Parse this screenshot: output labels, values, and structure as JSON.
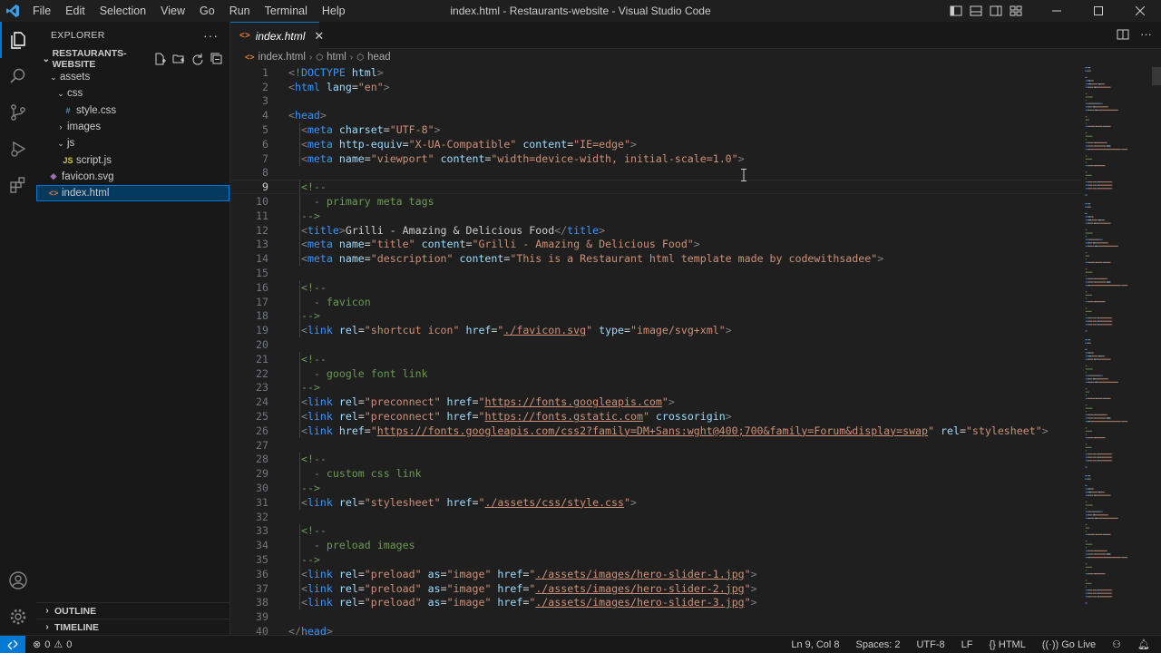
{
  "app": {
    "window_title": "index.html - Restaurants-website - Visual Studio Code",
    "menu": [
      "File",
      "Edit",
      "Selection",
      "View",
      "Go",
      "Run",
      "Terminal",
      "Help"
    ]
  },
  "sidebar": {
    "header": "EXPLORER",
    "section": "RESTAURANTS-WEBSITE",
    "tree": [
      {
        "label": "assets",
        "type": "folder",
        "open": true,
        "depth": 1
      },
      {
        "label": "css",
        "type": "folder",
        "open": true,
        "depth": 2
      },
      {
        "label": "style.css",
        "type": "css",
        "depth": 3
      },
      {
        "label": "images",
        "type": "folder",
        "open": false,
        "depth": 2
      },
      {
        "label": "js",
        "type": "folder",
        "open": true,
        "depth": 2
      },
      {
        "label": "script.js",
        "type": "js",
        "depth": 3
      },
      {
        "label": "favicon.svg",
        "type": "svg",
        "depth": 1
      },
      {
        "label": "index.html",
        "type": "html",
        "depth": 1,
        "selected": true
      }
    ],
    "outline": "OUTLINE",
    "timeline": "TIMELINE"
  },
  "editor": {
    "tab_label": "index.html",
    "breadcrumb": [
      "index.html",
      "html",
      "head"
    ],
    "current_line": 9,
    "lines": [
      [
        [
          "brk",
          "<!"
        ],
        [
          "tag",
          "DOCTYPE"
        ],
        [
          "txt",
          " "
        ],
        [
          "attr",
          "html"
        ],
        [
          "brk",
          ">"
        ]
      ],
      [
        [
          "brk",
          "<"
        ],
        [
          "tag",
          "html"
        ],
        [
          "txt",
          " "
        ],
        [
          "attr",
          "lang"
        ],
        [
          "txt",
          "="
        ],
        [
          "str",
          "\"en\""
        ],
        [
          "brk",
          ">"
        ]
      ],
      [],
      [
        [
          "brk",
          "<"
        ],
        [
          "tag",
          "head"
        ],
        [
          "brk",
          ">"
        ]
      ],
      [
        [
          "txt",
          "  "
        ],
        [
          "brk",
          "<"
        ],
        [
          "tag",
          "meta"
        ],
        [
          "txt",
          " "
        ],
        [
          "attr",
          "charset"
        ],
        [
          "txt",
          "="
        ],
        [
          "str",
          "\"UTF-8\""
        ],
        [
          "brk",
          ">"
        ]
      ],
      [
        [
          "txt",
          "  "
        ],
        [
          "brk",
          "<"
        ],
        [
          "tag",
          "meta"
        ],
        [
          "txt",
          " "
        ],
        [
          "attr",
          "http-equiv"
        ],
        [
          "txt",
          "="
        ],
        [
          "str",
          "\"X-UA-Compatible\""
        ],
        [
          "txt",
          " "
        ],
        [
          "attr",
          "content"
        ],
        [
          "txt",
          "="
        ],
        [
          "str",
          "\"IE=edge\""
        ],
        [
          "brk",
          ">"
        ]
      ],
      [
        [
          "txt",
          "  "
        ],
        [
          "brk",
          "<"
        ],
        [
          "tag",
          "meta"
        ],
        [
          "txt",
          " "
        ],
        [
          "attr",
          "name"
        ],
        [
          "txt",
          "="
        ],
        [
          "str",
          "\"viewport\""
        ],
        [
          "txt",
          " "
        ],
        [
          "attr",
          "content"
        ],
        [
          "txt",
          "="
        ],
        [
          "str",
          "\"width=device-width, initial-scale=1.0\""
        ],
        [
          "brk",
          ">"
        ]
      ],
      [],
      [
        [
          "txt",
          "  "
        ],
        [
          "cmt",
          "<!--"
        ]
      ],
      [
        [
          "txt",
          "  "
        ],
        [
          "cmt",
          "  - primary meta tags"
        ]
      ],
      [
        [
          "txt",
          "  "
        ],
        [
          "cmt",
          "-->"
        ]
      ],
      [
        [
          "txt",
          "  "
        ],
        [
          "brk",
          "<"
        ],
        [
          "tag",
          "title"
        ],
        [
          "brk",
          ">"
        ],
        [
          "txt",
          "Grilli - Amazing & Delicious Food"
        ],
        [
          "brk",
          "</"
        ],
        [
          "tag",
          "title"
        ],
        [
          "brk",
          ">"
        ]
      ],
      [
        [
          "txt",
          "  "
        ],
        [
          "brk",
          "<"
        ],
        [
          "tag",
          "meta"
        ],
        [
          "txt",
          " "
        ],
        [
          "attr",
          "name"
        ],
        [
          "txt",
          "="
        ],
        [
          "str",
          "\"title\""
        ],
        [
          "txt",
          " "
        ],
        [
          "attr",
          "content"
        ],
        [
          "txt",
          "="
        ],
        [
          "str",
          "\"Grilli - Amazing & Delicious Food\""
        ],
        [
          "brk",
          ">"
        ]
      ],
      [
        [
          "txt",
          "  "
        ],
        [
          "brk",
          "<"
        ],
        [
          "tag",
          "meta"
        ],
        [
          "txt",
          " "
        ],
        [
          "attr",
          "name"
        ],
        [
          "txt",
          "="
        ],
        [
          "str",
          "\"description\""
        ],
        [
          "txt",
          " "
        ],
        [
          "attr",
          "content"
        ],
        [
          "txt",
          "="
        ],
        [
          "str",
          "\"This is a Restaurant html template made by codewithsadee\""
        ],
        [
          "brk",
          ">"
        ]
      ],
      [],
      [
        [
          "txt",
          "  "
        ],
        [
          "cmt",
          "<!--"
        ]
      ],
      [
        [
          "txt",
          "  "
        ],
        [
          "cmt",
          "  - favicon"
        ]
      ],
      [
        [
          "txt",
          "  "
        ],
        [
          "cmt",
          "-->"
        ]
      ],
      [
        [
          "txt",
          "  "
        ],
        [
          "brk",
          "<"
        ],
        [
          "tag",
          "link"
        ],
        [
          "txt",
          " "
        ],
        [
          "attr",
          "rel"
        ],
        [
          "txt",
          "="
        ],
        [
          "str",
          "\"shortcut icon\""
        ],
        [
          "txt",
          " "
        ],
        [
          "attr",
          "href"
        ],
        [
          "txt",
          "="
        ],
        [
          "str",
          "\""
        ],
        [
          "url",
          "./favicon.svg"
        ],
        [
          "str",
          "\""
        ],
        [
          "txt",
          " "
        ],
        [
          "attr",
          "type"
        ],
        [
          "txt",
          "="
        ],
        [
          "str",
          "\"image/svg+xml\""
        ],
        [
          "brk",
          ">"
        ]
      ],
      [],
      [
        [
          "txt",
          "  "
        ],
        [
          "cmt",
          "<!--"
        ]
      ],
      [
        [
          "txt",
          "  "
        ],
        [
          "cmt",
          "  - google font link"
        ]
      ],
      [
        [
          "txt",
          "  "
        ],
        [
          "cmt",
          "-->"
        ]
      ],
      [
        [
          "txt",
          "  "
        ],
        [
          "brk",
          "<"
        ],
        [
          "tag",
          "link"
        ],
        [
          "txt",
          " "
        ],
        [
          "attr",
          "rel"
        ],
        [
          "txt",
          "="
        ],
        [
          "str",
          "\"preconnect\""
        ],
        [
          "txt",
          " "
        ],
        [
          "attr",
          "href"
        ],
        [
          "txt",
          "="
        ],
        [
          "str",
          "\""
        ],
        [
          "url",
          "https://fonts.googleapis.com"
        ],
        [
          "str",
          "\""
        ],
        [
          "brk",
          ">"
        ]
      ],
      [
        [
          "txt",
          "  "
        ],
        [
          "brk",
          "<"
        ],
        [
          "tag",
          "link"
        ],
        [
          "txt",
          " "
        ],
        [
          "attr",
          "rel"
        ],
        [
          "txt",
          "="
        ],
        [
          "str",
          "\"preconnect\""
        ],
        [
          "txt",
          " "
        ],
        [
          "attr",
          "href"
        ],
        [
          "txt",
          "="
        ],
        [
          "str",
          "\""
        ],
        [
          "url",
          "https://fonts.gstatic.com"
        ],
        [
          "str",
          "\""
        ],
        [
          "txt",
          " "
        ],
        [
          "attr",
          "crossorigin"
        ],
        [
          "brk",
          ">"
        ]
      ],
      [
        [
          "txt",
          "  "
        ],
        [
          "brk",
          "<"
        ],
        [
          "tag",
          "link"
        ],
        [
          "txt",
          " "
        ],
        [
          "attr",
          "href"
        ],
        [
          "txt",
          "="
        ],
        [
          "str",
          "\""
        ],
        [
          "url",
          "https://fonts.googleapis.com/css2?family=DM+Sans:wght@400;700&family=Forum&display=swap"
        ],
        [
          "str",
          "\""
        ],
        [
          "txt",
          " "
        ],
        [
          "attr",
          "rel"
        ],
        [
          "txt",
          "="
        ],
        [
          "str",
          "\"stylesheet\""
        ],
        [
          "brk",
          ">"
        ]
      ],
      [],
      [
        [
          "txt",
          "  "
        ],
        [
          "cmt",
          "<!--"
        ]
      ],
      [
        [
          "txt",
          "  "
        ],
        [
          "cmt",
          "  - custom css link"
        ]
      ],
      [
        [
          "txt",
          "  "
        ],
        [
          "cmt",
          "-->"
        ]
      ],
      [
        [
          "txt",
          "  "
        ],
        [
          "brk",
          "<"
        ],
        [
          "tag",
          "link"
        ],
        [
          "txt",
          " "
        ],
        [
          "attr",
          "rel"
        ],
        [
          "txt",
          "="
        ],
        [
          "str",
          "\"stylesheet\""
        ],
        [
          "txt",
          " "
        ],
        [
          "attr",
          "href"
        ],
        [
          "txt",
          "="
        ],
        [
          "str",
          "\""
        ],
        [
          "url",
          "./assets/css/style.css"
        ],
        [
          "str",
          "\""
        ],
        [
          "brk",
          ">"
        ]
      ],
      [],
      [
        [
          "txt",
          "  "
        ],
        [
          "cmt",
          "<!--"
        ]
      ],
      [
        [
          "txt",
          "  "
        ],
        [
          "cmt",
          "  - preload images"
        ]
      ],
      [
        [
          "txt",
          "  "
        ],
        [
          "cmt",
          "-->"
        ]
      ],
      [
        [
          "txt",
          "  "
        ],
        [
          "brk",
          "<"
        ],
        [
          "tag",
          "link"
        ],
        [
          "txt",
          " "
        ],
        [
          "attr",
          "rel"
        ],
        [
          "txt",
          "="
        ],
        [
          "str",
          "\"preload\""
        ],
        [
          "txt",
          " "
        ],
        [
          "attr",
          "as"
        ],
        [
          "txt",
          "="
        ],
        [
          "str",
          "\"image\""
        ],
        [
          "txt",
          " "
        ],
        [
          "attr",
          "href"
        ],
        [
          "txt",
          "="
        ],
        [
          "str",
          "\""
        ],
        [
          "url",
          "./assets/images/hero-slider-1.jpg"
        ],
        [
          "str",
          "\""
        ],
        [
          "brk",
          ">"
        ]
      ],
      [
        [
          "txt",
          "  "
        ],
        [
          "brk",
          "<"
        ],
        [
          "tag",
          "link"
        ],
        [
          "txt",
          " "
        ],
        [
          "attr",
          "rel"
        ],
        [
          "txt",
          "="
        ],
        [
          "str",
          "\"preload\""
        ],
        [
          "txt",
          " "
        ],
        [
          "attr",
          "as"
        ],
        [
          "txt",
          "="
        ],
        [
          "str",
          "\"image\""
        ],
        [
          "txt",
          " "
        ],
        [
          "attr",
          "href"
        ],
        [
          "txt",
          "="
        ],
        [
          "str",
          "\""
        ],
        [
          "url",
          "./assets/images/hero-slider-2.jpg"
        ],
        [
          "str",
          "\""
        ],
        [
          "brk",
          ">"
        ]
      ],
      [
        [
          "txt",
          "  "
        ],
        [
          "brk",
          "<"
        ],
        [
          "tag",
          "link"
        ],
        [
          "txt",
          " "
        ],
        [
          "attr",
          "rel"
        ],
        [
          "txt",
          "="
        ],
        [
          "str",
          "\"preload\""
        ],
        [
          "txt",
          " "
        ],
        [
          "attr",
          "as"
        ],
        [
          "txt",
          "="
        ],
        [
          "str",
          "\"image\""
        ],
        [
          "txt",
          " "
        ],
        [
          "attr",
          "href"
        ],
        [
          "txt",
          "="
        ],
        [
          "str",
          "\""
        ],
        [
          "url",
          "./assets/images/hero-slider-3.jpg"
        ],
        [
          "str",
          "\""
        ],
        [
          "brk",
          ">"
        ]
      ],
      [],
      [
        [
          "brk",
          "</"
        ],
        [
          "tag",
          "head"
        ],
        [
          "brk",
          ">"
        ]
      ]
    ]
  },
  "statusbar": {
    "errors": "0",
    "warnings": "0",
    "position": "Ln 9, Col 8",
    "spaces": "Spaces: 2",
    "encoding": "UTF-8",
    "eol": "LF",
    "language": "HTML",
    "golive": "Go Live"
  },
  "colors": {
    "accent": "#0078d4",
    "tag": "#3794ff",
    "attribute": "#9cdcfe",
    "string": "#ce9178",
    "comment": "#6a9955"
  }
}
